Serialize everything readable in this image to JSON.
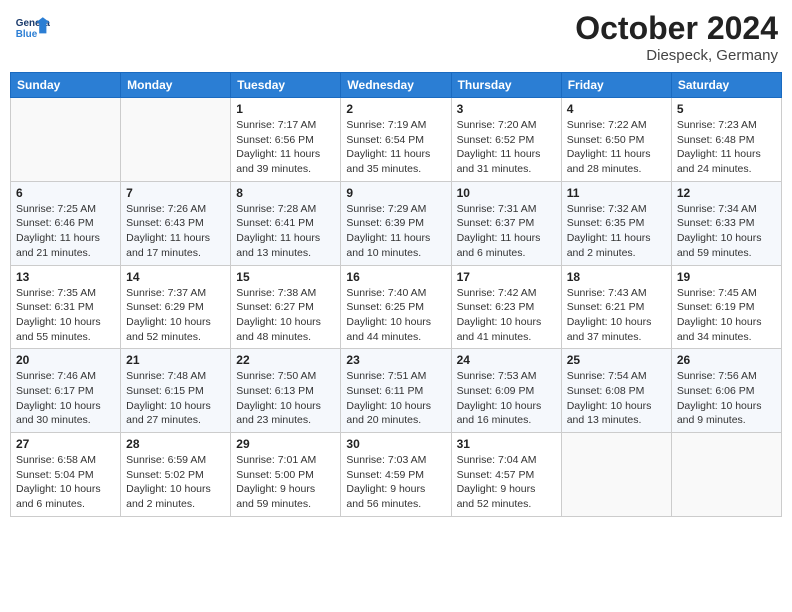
{
  "header": {
    "logo_general": "General",
    "logo_blue": "Blue",
    "title": "October 2024",
    "subtitle": "Diespeck, Germany"
  },
  "weekdays": [
    "Sunday",
    "Monday",
    "Tuesday",
    "Wednesday",
    "Thursday",
    "Friday",
    "Saturday"
  ],
  "weeks": [
    [
      {
        "day": "",
        "empty": true
      },
      {
        "day": "",
        "empty": true
      },
      {
        "day": "1",
        "sunrise": "Sunrise: 7:17 AM",
        "sunset": "Sunset: 6:56 PM",
        "daylight": "Daylight: 11 hours and 39 minutes."
      },
      {
        "day": "2",
        "sunrise": "Sunrise: 7:19 AM",
        "sunset": "Sunset: 6:54 PM",
        "daylight": "Daylight: 11 hours and 35 minutes."
      },
      {
        "day": "3",
        "sunrise": "Sunrise: 7:20 AM",
        "sunset": "Sunset: 6:52 PM",
        "daylight": "Daylight: 11 hours and 31 minutes."
      },
      {
        "day": "4",
        "sunrise": "Sunrise: 7:22 AM",
        "sunset": "Sunset: 6:50 PM",
        "daylight": "Daylight: 11 hours and 28 minutes."
      },
      {
        "day": "5",
        "sunrise": "Sunrise: 7:23 AM",
        "sunset": "Sunset: 6:48 PM",
        "daylight": "Daylight: 11 hours and 24 minutes."
      }
    ],
    [
      {
        "day": "6",
        "sunrise": "Sunrise: 7:25 AM",
        "sunset": "Sunset: 6:46 PM",
        "daylight": "Daylight: 11 hours and 21 minutes."
      },
      {
        "day": "7",
        "sunrise": "Sunrise: 7:26 AM",
        "sunset": "Sunset: 6:43 PM",
        "daylight": "Daylight: 11 hours and 17 minutes."
      },
      {
        "day": "8",
        "sunrise": "Sunrise: 7:28 AM",
        "sunset": "Sunset: 6:41 PM",
        "daylight": "Daylight: 11 hours and 13 minutes."
      },
      {
        "day": "9",
        "sunrise": "Sunrise: 7:29 AM",
        "sunset": "Sunset: 6:39 PM",
        "daylight": "Daylight: 11 hours and 10 minutes."
      },
      {
        "day": "10",
        "sunrise": "Sunrise: 7:31 AM",
        "sunset": "Sunset: 6:37 PM",
        "daylight": "Daylight: 11 hours and 6 minutes."
      },
      {
        "day": "11",
        "sunrise": "Sunrise: 7:32 AM",
        "sunset": "Sunset: 6:35 PM",
        "daylight": "Daylight: 11 hours and 2 minutes."
      },
      {
        "day": "12",
        "sunrise": "Sunrise: 7:34 AM",
        "sunset": "Sunset: 6:33 PM",
        "daylight": "Daylight: 10 hours and 59 minutes."
      }
    ],
    [
      {
        "day": "13",
        "sunrise": "Sunrise: 7:35 AM",
        "sunset": "Sunset: 6:31 PM",
        "daylight": "Daylight: 10 hours and 55 minutes."
      },
      {
        "day": "14",
        "sunrise": "Sunrise: 7:37 AM",
        "sunset": "Sunset: 6:29 PM",
        "daylight": "Daylight: 10 hours and 52 minutes."
      },
      {
        "day": "15",
        "sunrise": "Sunrise: 7:38 AM",
        "sunset": "Sunset: 6:27 PM",
        "daylight": "Daylight: 10 hours and 48 minutes."
      },
      {
        "day": "16",
        "sunrise": "Sunrise: 7:40 AM",
        "sunset": "Sunset: 6:25 PM",
        "daylight": "Daylight: 10 hours and 44 minutes."
      },
      {
        "day": "17",
        "sunrise": "Sunrise: 7:42 AM",
        "sunset": "Sunset: 6:23 PM",
        "daylight": "Daylight: 10 hours and 41 minutes."
      },
      {
        "day": "18",
        "sunrise": "Sunrise: 7:43 AM",
        "sunset": "Sunset: 6:21 PM",
        "daylight": "Daylight: 10 hours and 37 minutes."
      },
      {
        "day": "19",
        "sunrise": "Sunrise: 7:45 AM",
        "sunset": "Sunset: 6:19 PM",
        "daylight": "Daylight: 10 hours and 34 minutes."
      }
    ],
    [
      {
        "day": "20",
        "sunrise": "Sunrise: 7:46 AM",
        "sunset": "Sunset: 6:17 PM",
        "daylight": "Daylight: 10 hours and 30 minutes."
      },
      {
        "day": "21",
        "sunrise": "Sunrise: 7:48 AM",
        "sunset": "Sunset: 6:15 PM",
        "daylight": "Daylight: 10 hours and 27 minutes."
      },
      {
        "day": "22",
        "sunrise": "Sunrise: 7:50 AM",
        "sunset": "Sunset: 6:13 PM",
        "daylight": "Daylight: 10 hours and 23 minutes."
      },
      {
        "day": "23",
        "sunrise": "Sunrise: 7:51 AM",
        "sunset": "Sunset: 6:11 PM",
        "daylight": "Daylight: 10 hours and 20 minutes."
      },
      {
        "day": "24",
        "sunrise": "Sunrise: 7:53 AM",
        "sunset": "Sunset: 6:09 PM",
        "daylight": "Daylight: 10 hours and 16 minutes."
      },
      {
        "day": "25",
        "sunrise": "Sunrise: 7:54 AM",
        "sunset": "Sunset: 6:08 PM",
        "daylight": "Daylight: 10 hours and 13 minutes."
      },
      {
        "day": "26",
        "sunrise": "Sunrise: 7:56 AM",
        "sunset": "Sunset: 6:06 PM",
        "daylight": "Daylight: 10 hours and 9 minutes."
      }
    ],
    [
      {
        "day": "27",
        "sunrise": "Sunrise: 6:58 AM",
        "sunset": "Sunset: 5:04 PM",
        "daylight": "Daylight: 10 hours and 6 minutes."
      },
      {
        "day": "28",
        "sunrise": "Sunrise: 6:59 AM",
        "sunset": "Sunset: 5:02 PM",
        "daylight": "Daylight: 10 hours and 2 minutes."
      },
      {
        "day": "29",
        "sunrise": "Sunrise: 7:01 AM",
        "sunset": "Sunset: 5:00 PM",
        "daylight": "Daylight: 9 hours and 59 minutes."
      },
      {
        "day": "30",
        "sunrise": "Sunrise: 7:03 AM",
        "sunset": "Sunset: 4:59 PM",
        "daylight": "Daylight: 9 hours and 56 minutes."
      },
      {
        "day": "31",
        "sunrise": "Sunrise: 7:04 AM",
        "sunset": "Sunset: 4:57 PM",
        "daylight": "Daylight: 9 hours and 52 minutes."
      },
      {
        "day": "",
        "empty": true
      },
      {
        "day": "",
        "empty": true
      }
    ]
  ]
}
